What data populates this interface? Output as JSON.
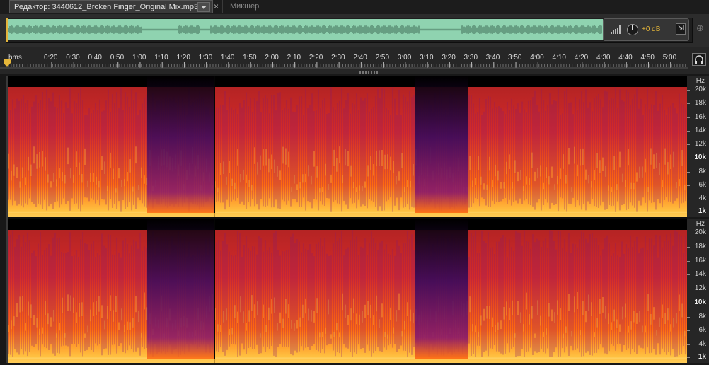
{
  "tabs": {
    "editor_title": "Редактор: 3440612_Broken Finger_Original Mix.mp3",
    "close_glyph": "×",
    "mixer_label": "Микшер"
  },
  "overview": {
    "waveform_color": "#8fd3b0",
    "gain_value": "+0 dB"
  },
  "ruler": {
    "labels": [
      "hms",
      "0:20",
      "0:30",
      "0:40",
      "0:50",
      "1:00",
      "1:10",
      "1:20",
      "1:30",
      "1:40",
      "1:50",
      "2:00",
      "2:10",
      "2:20",
      "2:30",
      "2:40",
      "2:50",
      "3:00",
      "3:10",
      "3:20",
      "3:30",
      "3:40",
      "3:50",
      "4:00",
      "4:10",
      "4:20",
      "4:30",
      "4:40",
      "4:50",
      "5:00"
    ]
  },
  "frequency_axis": {
    "unit": "Hz",
    "labels": [
      "20k",
      "18k",
      "16k",
      "14k",
      "12k",
      "10k",
      "8k",
      "6k",
      "4k",
      "1k"
    ],
    "strong_labels": [
      "10k",
      "1k"
    ]
  },
  "spectrogram": {
    "channels": 2,
    "colormap": [
      "#000000",
      "#3a0a5c",
      "#8a1a6a",
      "#d42a2a",
      "#ff6a10",
      "#ffc040",
      "#fff0a0"
    ]
  },
  "icons": {
    "playhead": "playhead-marker-icon",
    "volume": "volume-bars-icon",
    "knob": "gain-knob-icon",
    "pin": "pin-icon",
    "headphones": "headphones-icon",
    "zoom": "zoom-navigation-icon",
    "dropdown": "chevron-down-icon"
  }
}
